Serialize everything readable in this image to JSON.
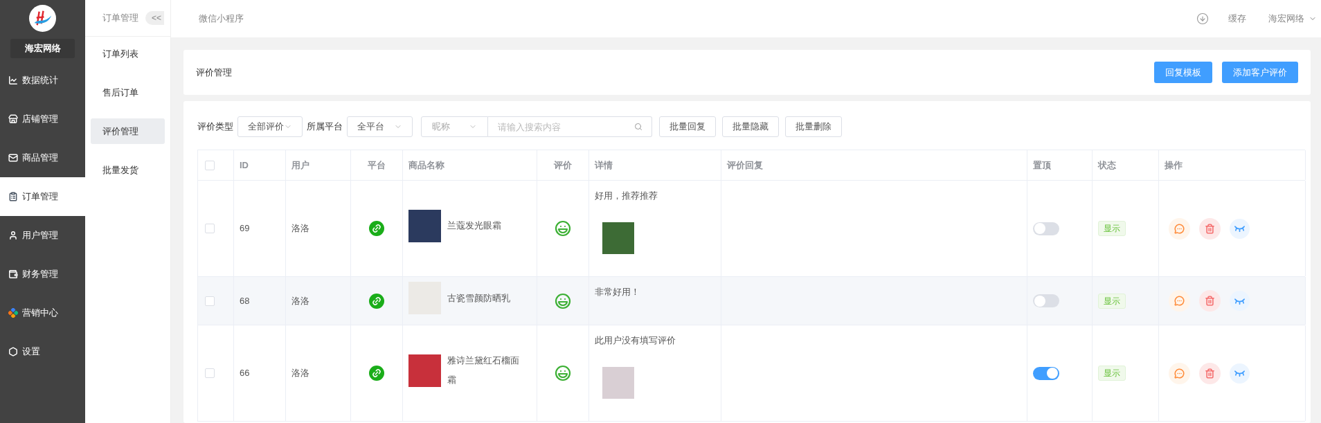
{
  "sidebar": {
    "brand": "海宏网络",
    "items": [
      {
        "label": "数据统计",
        "selected": false
      },
      {
        "label": "店铺管理",
        "selected": false
      },
      {
        "label": "商品管理",
        "selected": false
      },
      {
        "label": "订单管理",
        "selected": true
      },
      {
        "label": "用户管理",
        "selected": false
      },
      {
        "label": "财务管理",
        "selected": false
      },
      {
        "label": "营销中心",
        "selected": false
      },
      {
        "label": "设置",
        "selected": false
      }
    ]
  },
  "submenu": {
    "title": "订单管理",
    "collapse": "<<",
    "items": [
      {
        "label": "订单列表",
        "selected": false
      },
      {
        "label": "售后订单",
        "selected": false
      },
      {
        "label": "评价管理",
        "selected": true
      },
      {
        "label": "批量发货",
        "selected": false
      }
    ]
  },
  "topbar": {
    "tab": "微信小程序",
    "cache": "缓存",
    "account": "海宏网络"
  },
  "header": {
    "title": "评价管理",
    "buttons": [
      "回复模板",
      "添加客户评价"
    ]
  },
  "filters": {
    "type_label": "评价类型",
    "type_value": "全部评价",
    "platform_label": "所属平台",
    "platform_value": "全平台",
    "search_field": "昵称",
    "search_placeholder": "请输入搜索内容",
    "buttons": [
      "批量回复",
      "批量隐藏",
      "批量删除"
    ]
  },
  "table": {
    "all_checked": false,
    "columns": [
      "ID",
      "用户",
      "平台",
      "商品名称",
      "评价",
      "详情",
      "评价回复",
      "置顶",
      "状态",
      "操作"
    ],
    "rows": [
      {
        "checked": false,
        "highlighted": false,
        "id": "69",
        "user": "洛洛",
        "product": "兰蔻发光眼霜",
        "detail": "好用，推荐推荐",
        "has_photo": true,
        "pinned": false,
        "status": "显示"
      },
      {
        "checked": false,
        "highlighted": true,
        "id": "68",
        "user": "洛洛",
        "product": "古瓷雪颜防晒乳",
        "detail": "非常好用！",
        "has_photo": false,
        "pinned": false,
        "status": "显示"
      },
      {
        "checked": false,
        "highlighted": false,
        "id": "66",
        "user": "洛洛",
        "product": "雅诗兰黛红石榴面霜",
        "detail": "此用户没有填写评价",
        "has_photo": true,
        "pinned": true,
        "status": "显示"
      }
    ]
  }
}
